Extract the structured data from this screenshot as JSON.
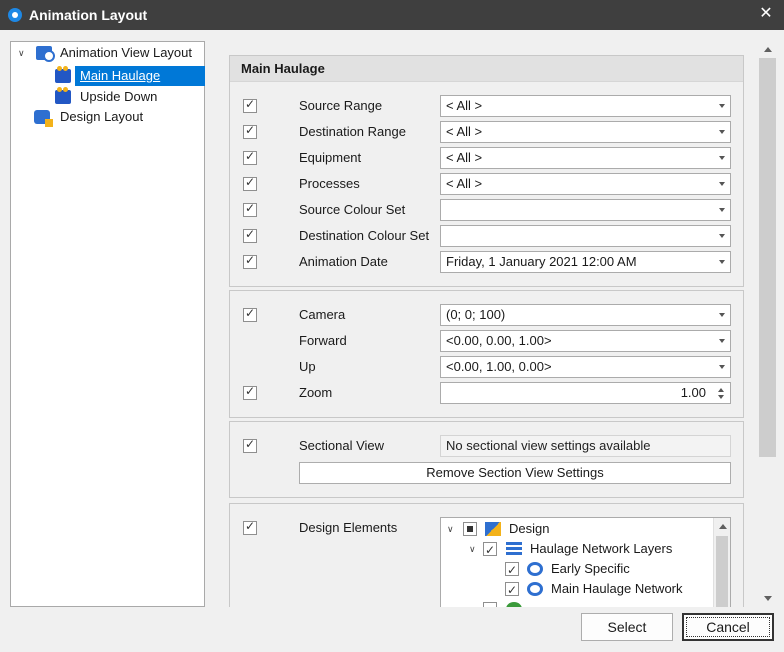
{
  "window": {
    "title": "Animation Layout",
    "close_icon": "close-icon"
  },
  "tree": {
    "items": [
      {
        "label": "Animation View Layout",
        "icon": "animation-view-icon",
        "expanded": true
      },
      {
        "label": "Main Haulage",
        "icon": "camera-icon",
        "selected": true
      },
      {
        "label": "Upside Down",
        "icon": "camera-icon"
      },
      {
        "label": "Design Layout",
        "icon": "design-layout-icon"
      }
    ]
  },
  "main": {
    "header": "Main Haulage",
    "fields": [
      {
        "label": "Source Range",
        "value": "< All >",
        "checked": true
      },
      {
        "label": "Destination Range",
        "value": "< All >",
        "checked": true
      },
      {
        "label": "Equipment",
        "value": "< All >",
        "checked": true
      },
      {
        "label": "Processes",
        "value": "< All >",
        "checked": true
      },
      {
        "label": "Source Colour Set",
        "value": "",
        "checked": true
      },
      {
        "label": "Destination Colour Set",
        "value": "",
        "checked": true
      },
      {
        "label": "Animation Date",
        "value": "Friday, 1 January 2021 12:00 AM",
        "checked": true
      }
    ]
  },
  "camera": {
    "camera_label": "Camera",
    "camera_value": "(0; 0; 100)",
    "forward_label": "Forward",
    "forward_value": "<0.00, 0.00, 1.00>",
    "up_label": "Up",
    "up_value": "<0.00, 1.00, 0.00>",
    "zoom_label": "Zoom",
    "zoom_value": "1.00"
  },
  "sectional": {
    "label": "Sectional View",
    "value": "No sectional view settings available",
    "remove_button": "Remove Section View Settings"
  },
  "design": {
    "label": "Design Elements",
    "items": [
      {
        "label": "Design",
        "state": "partial"
      },
      {
        "label": "Haulage Network Layers",
        "state": "checked"
      },
      {
        "label": "Early Specific",
        "state": "checked"
      },
      {
        "label": "Main Haulage Network",
        "state": "checked"
      }
    ]
  },
  "buttons": {
    "select": "Select",
    "cancel": "Cancel"
  },
  "colors": {
    "titlebar": "#3f3f3f",
    "selection": "#0078d7",
    "icon_blue": "#2e6fd0",
    "icon_yellow": "#f3b21a"
  }
}
